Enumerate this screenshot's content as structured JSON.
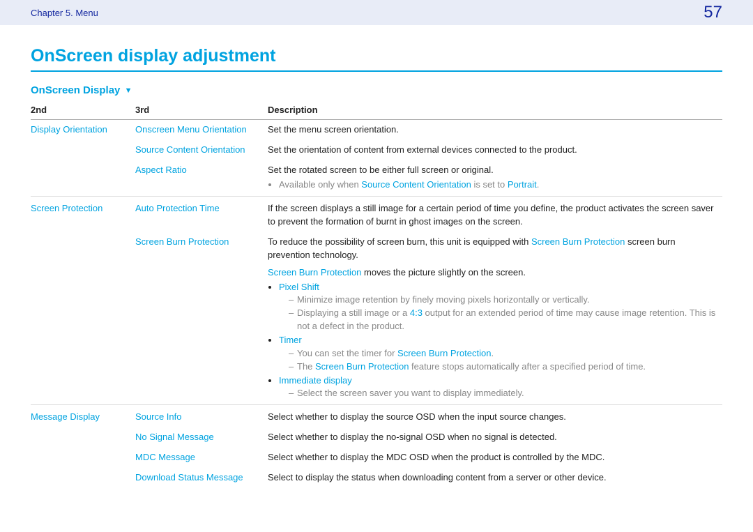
{
  "header": {
    "chapter": "Chapter 5.  Menu",
    "page": "57"
  },
  "title": "OnScreen display adjustment",
  "section": "OnScreen Display",
  "columns": {
    "c1": "2nd",
    "c2": "3rd",
    "c3": "Description"
  },
  "rows": {
    "display_orientation": {
      "label": "Display Orientation",
      "onscreen_menu": {
        "label": "Onscreen Menu Orientation",
        "desc": "Set the menu screen orientation."
      },
      "source_content": {
        "label": "Source Content Orientation",
        "desc": "Set the orientation of content from external devices connected to the product."
      },
      "aspect_ratio": {
        "label": "Aspect Ratio",
        "desc": "Set the rotated screen to be either full screen or original.",
        "note_pre": "Available only when ",
        "note_link1": "Source Content Orientation",
        "note_mid": " is set to ",
        "note_link2": "Portrait",
        "note_post": "."
      }
    },
    "screen_protection": {
      "label": "Screen Protection",
      "auto_protection": {
        "label": "Auto Protection Time",
        "desc": "If the screen displays a still image for a certain period of time you define, the product activates the screen saver to prevent the formation of burnt in ghost images on the screen."
      },
      "screen_burn": {
        "label": "Screen Burn Protection",
        "desc_pre": "To reduce the possibility of screen burn, this unit is equipped with ",
        "desc_link": "Screen Burn Protection",
        "desc_post": " screen burn prevention technology.",
        "moves_link": "Screen Burn Protection",
        "moves_post": " moves the picture slightly on the screen.",
        "pixel_shift": {
          "label": "Pixel Shift",
          "d1": "Minimize image retention by finely moving pixels horizontally or vertically.",
          "d2_pre": "Displaying a still image or a ",
          "d2_ratio": "4:3",
          "d2_post": " output for an extended period of time may cause image retention. This is not a defect in the product."
        },
        "timer": {
          "label": "Timer",
          "d1_pre": "You can set the timer for ",
          "d1_link": "Screen Burn Protection",
          "d1_post": ".",
          "d2_pre": "The ",
          "d2_link": "Screen Burn Protection",
          "d2_post": " feature stops automatically after a specified period of time."
        },
        "immediate": {
          "label": "Immediate display",
          "d1": "Select the screen saver you want to display immediately."
        }
      }
    },
    "message_display": {
      "label": "Message Display",
      "source_info": {
        "label": "Source Info",
        "desc": "Select whether to display the source OSD when the input source changes."
      },
      "no_signal": {
        "label": "No Signal Message",
        "desc": "Select whether to display the no-signal OSD when no signal is detected."
      },
      "mdc": {
        "label": "MDC Message",
        "desc": "Select whether to display the MDC OSD when the product is controlled by the MDC."
      },
      "download": {
        "label": "Download Status Message",
        "desc": "Select to display the status when downloading content from a server or other device."
      }
    }
  }
}
